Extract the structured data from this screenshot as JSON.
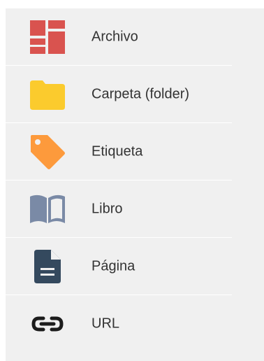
{
  "items": [
    {
      "label": "Archivo",
      "icon": "archive-grid-icon",
      "color": "#d9534f"
    },
    {
      "label": "Carpeta (folder)",
      "icon": "folder-icon",
      "color": "#fbcb2d"
    },
    {
      "label": "Etiqueta",
      "icon": "tag-icon",
      "color": "#fd9a3c"
    },
    {
      "label": "Libro",
      "icon": "book-icon",
      "color": "#7a8aa6"
    },
    {
      "label": "Página",
      "icon": "page-icon",
      "color": "#34495e"
    },
    {
      "label": "URL",
      "icon": "link-icon",
      "color": "#1c1c1c"
    }
  ]
}
